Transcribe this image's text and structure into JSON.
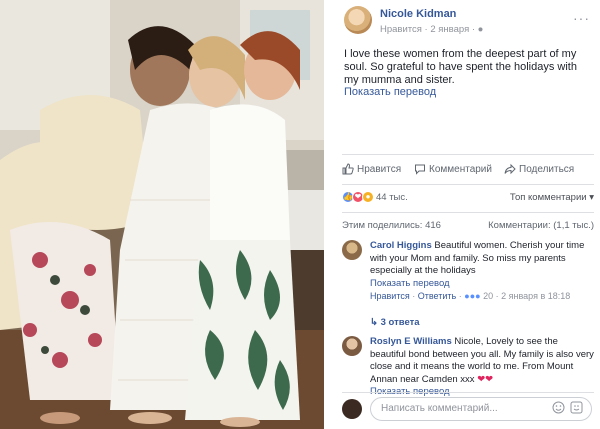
{
  "post": {
    "author": "Nicole Kidman",
    "meta_text": "Нравится · 2 января ·",
    "text": "I love these women from the deepest part of my soul. So grateful to have spent the holidays with my mumma and sister.",
    "translate_label": "Показать перевод"
  },
  "actions": {
    "like": "Нравится",
    "comment": "Комментарий",
    "share": "Поделиться"
  },
  "stats": {
    "reactions_count": "44 тыс.",
    "sort_label": "Топ комментарии ▾",
    "shares_label": "Этим поделились: 416",
    "comments_label": "Комментарии: (1,1 тыс.)"
  },
  "comments": [
    {
      "name": "Carol Higgins",
      "text": "Beautiful women. Cherish your time with your Mom and family. So miss my parents especially at the holidays",
      "translate": "Показать перевод",
      "like_label": "Нравится",
      "reply_label": "Ответить",
      "reaction_count": "20",
      "date": "2 января в 18:18",
      "replies_label": "3 ответа"
    },
    {
      "name": "Roslyn E Williams",
      "text": "Nicole, Lovely to see the beautiful bond between you all. My family is also very close and it means the world to me. From Mount Annan near Camden xxx",
      "translate": "Показать перевод"
    }
  ],
  "composer": {
    "placeholder": "Написать комментарий..."
  },
  "colors": {
    "link": "#365899",
    "muted": "#90949c",
    "divider": "#dddfe2"
  }
}
